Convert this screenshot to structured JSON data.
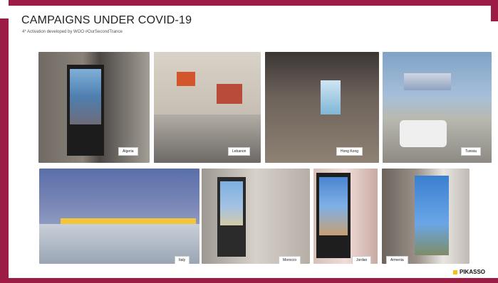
{
  "slide": {
    "title": "CAMPAIGNS UNDER COVID-19",
    "subtitle": "4* Activation developed by WOO #OurSecondTrance"
  },
  "photos": [
    {
      "label": "Algeria"
    },
    {
      "label": "Lebanon"
    },
    {
      "label": "Hong Kong"
    },
    {
      "label": "Tunisia"
    },
    {
      "label": "Italy"
    },
    {
      "label": "Morocco"
    },
    {
      "label": "Jordan"
    },
    {
      "label": "Armenia"
    }
  ],
  "brand": {
    "logo_text": "PIKASSO",
    "accent_color": "#9b1c44",
    "logo_color": "#f2c01d"
  }
}
